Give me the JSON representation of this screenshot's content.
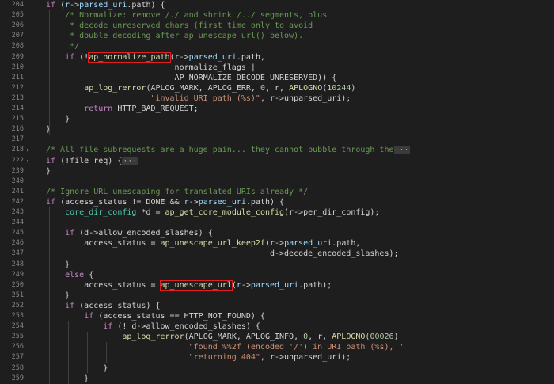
{
  "editor": {
    "lines": [
      {
        "n": "204",
        "fold": "",
        "segs": [
          [
            "kw",
            "if"
          ],
          [
            "op",
            " ("
          ],
          [
            "id",
            "r"
          ],
          [
            "op",
            "->"
          ],
          [
            "id",
            "parsed_uri"
          ],
          [
            "op",
            ".path) {"
          ]
        ]
      },
      {
        "n": "205",
        "fold": "",
        "segs": [
          [
            "cm",
            "    /* Normalize: remove /./ and shrink /../ segments, plus"
          ]
        ]
      },
      {
        "n": "206",
        "fold": "",
        "segs": [
          [
            "cm",
            "     * decode unreserved chars (first time only to avoid"
          ]
        ]
      },
      {
        "n": "207",
        "fold": "",
        "segs": [
          [
            "cm",
            "     * double decoding after ap_unescape_url() below)."
          ]
        ]
      },
      {
        "n": "208",
        "fold": "",
        "segs": [
          [
            "cm",
            "     */"
          ]
        ]
      },
      {
        "n": "209",
        "fold": "",
        "segs": [
          [
            "op",
            "    "
          ],
          [
            "kw",
            "if"
          ],
          [
            "op",
            " (!"
          ],
          [
            "fnhl",
            "ap_normalize_path"
          ],
          [
            "op",
            "("
          ],
          [
            "id",
            "r"
          ],
          [
            "op",
            "->"
          ],
          [
            "id",
            "parsed_uri"
          ],
          [
            "op",
            ".path,"
          ]
        ]
      },
      {
        "n": "210",
        "fold": "",
        "segs": [
          [
            "op",
            "                           normalize_flags |"
          ]
        ]
      },
      {
        "n": "211",
        "fold": "",
        "segs": [
          [
            "op",
            "                           AP_NORMALIZE_DECODE_UNRESERVED)) {"
          ]
        ]
      },
      {
        "n": "212",
        "fold": "",
        "segs": [
          [
            "op",
            "        "
          ],
          [
            "fn",
            "ap_log_rerror"
          ],
          [
            "op",
            "(APLOG_MARK, APLOG_ERR, "
          ],
          [
            "num",
            "0"
          ],
          [
            "op",
            ", r, "
          ],
          [
            "fn",
            "APLOGNO"
          ],
          [
            "op",
            "("
          ],
          [
            "num",
            "10244"
          ],
          [
            "op",
            ")"
          ]
        ]
      },
      {
        "n": "213",
        "fold": "",
        "segs": [
          [
            "op",
            "                      "
          ],
          [
            "str",
            "\"invalid URI path (%s)\""
          ],
          [
            "op",
            ", r->unparsed_uri);"
          ]
        ]
      },
      {
        "n": "214",
        "fold": "",
        "segs": [
          [
            "op",
            "        "
          ],
          [
            "kw",
            "return"
          ],
          [
            "op",
            " HTTP_BAD_REQUEST;"
          ]
        ]
      },
      {
        "n": "215",
        "fold": "",
        "segs": [
          [
            "op",
            "    }"
          ]
        ]
      },
      {
        "n": "216",
        "fold": "",
        "segs": [
          [
            "op",
            "}"
          ]
        ]
      },
      {
        "n": "217",
        "fold": "",
        "segs": []
      },
      {
        "n": "218",
        "fold": "›",
        "segs": [
          [
            "cm",
            "/* All file subrequests are a huge pain... they cannot bubble through the"
          ],
          [
            "ell",
            "···"
          ]
        ]
      },
      {
        "n": "222",
        "fold": "›",
        "segs": [
          [
            "kw",
            "if"
          ],
          [
            "op",
            " (!file_req) {"
          ],
          [
            "ell",
            "···"
          ]
        ]
      },
      {
        "n": "239",
        "fold": "",
        "segs": [
          [
            "op",
            "}"
          ]
        ]
      },
      {
        "n": "240",
        "fold": "",
        "segs": []
      },
      {
        "n": "241",
        "fold": "",
        "segs": [
          [
            "cm",
            "/* Ignore URL unescaping for translated URIs already */"
          ]
        ]
      },
      {
        "n": "242",
        "fold": "",
        "segs": [
          [
            "kw",
            "if"
          ],
          [
            "op",
            " (access_status != DONE && "
          ],
          [
            "id",
            "r"
          ],
          [
            "op",
            "->"
          ],
          [
            "id",
            "parsed_uri"
          ],
          [
            "op",
            ".path) {"
          ]
        ]
      },
      {
        "n": "243",
        "fold": "",
        "segs": [
          [
            "op",
            "    "
          ],
          [
            "ty",
            "core_dir_config"
          ],
          [
            "op",
            " *d = "
          ],
          [
            "fn",
            "ap_get_core_module_config"
          ],
          [
            "op",
            "(r->per_dir_config);"
          ]
        ]
      },
      {
        "n": "244",
        "fold": "",
        "segs": []
      },
      {
        "n": "245",
        "fold": "",
        "segs": [
          [
            "op",
            "    "
          ],
          [
            "kw",
            "if"
          ],
          [
            "op",
            " (d->allow_encoded_slashes) {"
          ]
        ]
      },
      {
        "n": "246",
        "fold": "",
        "segs": [
          [
            "op",
            "        access_status = "
          ],
          [
            "fn",
            "ap_unescape_url_keep2f"
          ],
          [
            "op",
            "("
          ],
          [
            "id",
            "r"
          ],
          [
            "op",
            "->"
          ],
          [
            "id",
            "parsed_uri"
          ],
          [
            "op",
            ".path,"
          ]
        ]
      },
      {
        "n": "247",
        "fold": "",
        "segs": [
          [
            "op",
            "                                               d->decode_encoded_slashes);"
          ]
        ]
      },
      {
        "n": "248",
        "fold": "",
        "segs": [
          [
            "op",
            "    }"
          ]
        ]
      },
      {
        "n": "249",
        "fold": "",
        "segs": [
          [
            "op",
            "    "
          ],
          [
            "kw",
            "else"
          ],
          [
            "op",
            " {"
          ]
        ]
      },
      {
        "n": "250",
        "fold": "",
        "segs": [
          [
            "op",
            "        access_status = "
          ],
          [
            "fnhl",
            "ap_unescape_url"
          ],
          [
            "op",
            "("
          ],
          [
            "id",
            "r"
          ],
          [
            "op",
            "->"
          ],
          [
            "id",
            "parsed_uri"
          ],
          [
            "op",
            ".path);"
          ]
        ]
      },
      {
        "n": "251",
        "fold": "",
        "segs": [
          [
            "op",
            "    }"
          ]
        ]
      },
      {
        "n": "252",
        "fold": "",
        "segs": [
          [
            "op",
            "    "
          ],
          [
            "kw",
            "if"
          ],
          [
            "op",
            " (access_status) {"
          ]
        ]
      },
      {
        "n": "253",
        "fold": "",
        "segs": [
          [
            "op",
            "        "
          ],
          [
            "kw",
            "if"
          ],
          [
            "op",
            " (access_status == HTTP_NOT_FOUND) {"
          ]
        ]
      },
      {
        "n": "254",
        "fold": "",
        "segs": [
          [
            "op",
            "            "
          ],
          [
            "kw",
            "if"
          ],
          [
            "op",
            " (! d->allow_encoded_slashes) {"
          ]
        ]
      },
      {
        "n": "255",
        "fold": "",
        "segs": [
          [
            "op",
            "                "
          ],
          [
            "fn",
            "ap_log_rerror"
          ],
          [
            "op",
            "(APLOG_MARK, APLOG_INFO, "
          ],
          [
            "num",
            "0"
          ],
          [
            "op",
            ", r, "
          ],
          [
            "fn",
            "APLOGNO"
          ],
          [
            "op",
            "("
          ],
          [
            "num",
            "00026"
          ],
          [
            "op",
            ")"
          ]
        ]
      },
      {
        "n": "256",
        "fold": "",
        "segs": [
          [
            "op",
            "                              "
          ],
          [
            "str",
            "\"found %%2f (encoded '/') in URI path (%s), \""
          ]
        ]
      },
      {
        "n": "257",
        "fold": "",
        "segs": [
          [
            "op",
            "                              "
          ],
          [
            "str",
            "\"returning 404\""
          ],
          [
            "op",
            ", r->unparsed_uri);"
          ]
        ]
      },
      {
        "n": "258",
        "fold": "",
        "segs": [
          [
            "op",
            "            }"
          ]
        ]
      },
      {
        "n": "259",
        "fold": "",
        "segs": [
          [
            "op",
            "        }"
          ]
        ]
      }
    ]
  }
}
